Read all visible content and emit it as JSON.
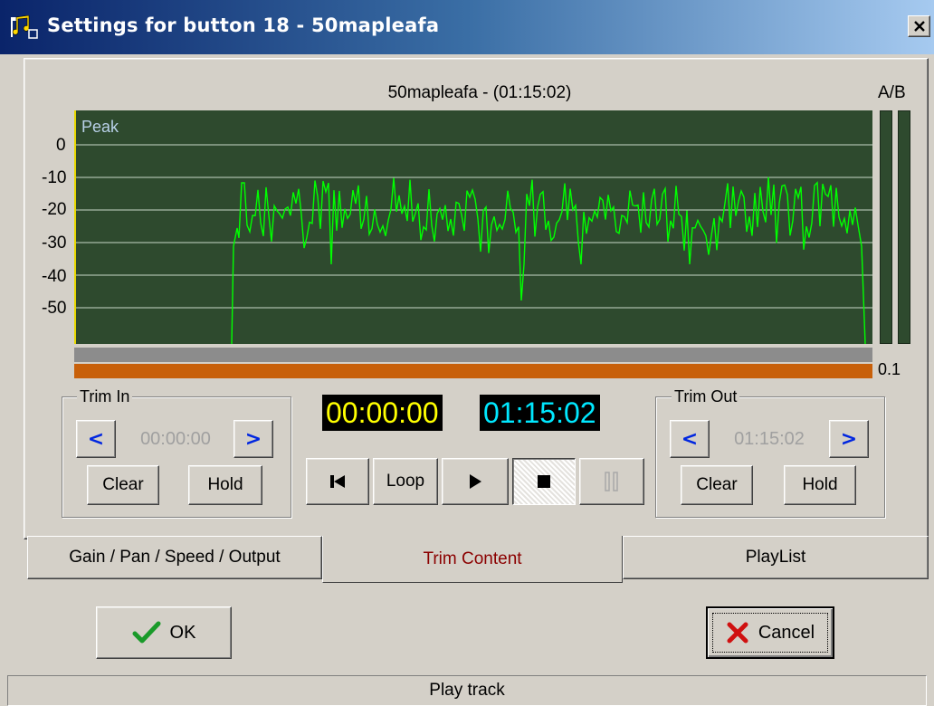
{
  "window": {
    "title": "Settings for button 18 - 50mapleafa",
    "close_label": "X"
  },
  "waveform": {
    "title": "50mapleafa - (01:15:02)",
    "peak_label": "Peak",
    "ab_label": "A/B",
    "y_ticks": [
      "0",
      "-10",
      "-20",
      "-30",
      "-40",
      "-50"
    ],
    "meter_value": "0.1",
    "colors": {
      "background": "#2e4a2e",
      "trace": "#00ff00",
      "grid": "#c8d8c8",
      "cursor": "#e8d800",
      "marker_bar": "#c8600a"
    }
  },
  "trim_in": {
    "legend": "Trim In",
    "prev_label": "<",
    "next_label": ">",
    "time": "00:00:00",
    "clear_label": "Clear",
    "hold_label": "Hold"
  },
  "trim_out": {
    "legend": "Trim Out",
    "prev_label": "<",
    "next_label": ">",
    "time": "01:15:02",
    "clear_label": "Clear",
    "hold_label": "Hold"
  },
  "transport": {
    "position_time": "00:00:00",
    "length_time": "01:15:02",
    "loop_label": "Loop",
    "buttons": [
      "skip-to-start-icon",
      "loop",
      "play-icon",
      "stop-icon",
      "pause-icon"
    ]
  },
  "tabs": [
    {
      "label": "Gain / Pan / Speed / Output"
    },
    {
      "label": "Trim Content",
      "active": true
    },
    {
      "label": "PlayList"
    }
  ],
  "footer": {
    "ok_label": "OK",
    "cancel_label": "Cancel"
  },
  "status": {
    "text": "Play track"
  }
}
